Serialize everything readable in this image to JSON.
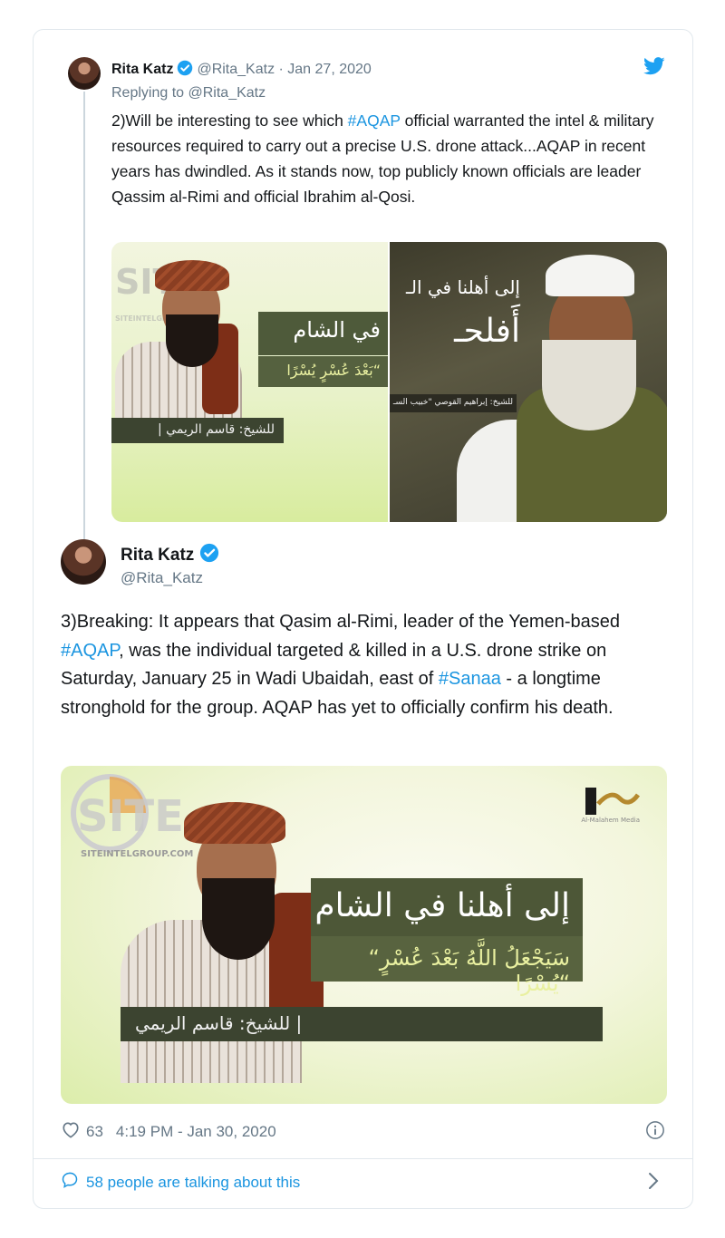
{
  "reply_tweet": {
    "author_name": "Rita Katz",
    "handle_date": "@Rita_Katz · Jan 27, 2020",
    "replying_to": "Replying to @Rita_Katz",
    "text_before_tag": "2)Will be interesting to see which ",
    "hashtag": "#AQAP",
    "text_after_tag": " official warranted the intel & military resources required to carry out a precise U.S. drone attack...AQAP in recent years has dwindled. As it stands now, top publicly known officials are leader Qassim al-Rimi and official Ibrahim al-Qosi.",
    "images": {
      "left": {
        "watermark": "SITE",
        "watermark_url": "SITEINTELGROUP.COM",
        "banner_title": "في الشام",
        "banner_quote": "بَعْدَ عُسْرٍ يُسْرًا“",
        "caption": "| للشيخ: قاسم الريمي"
      },
      "right": {
        "title_line1": "إلى أهلنا في الـ",
        "title_line2": "أَفلحـ",
        "caption": "للشيخ: إبراهيم القوصي \"خبيب السـ"
      }
    }
  },
  "main_tweet": {
    "author_name": "Rita Katz",
    "handle": "@Rita_Katz",
    "text_part1": "3)Breaking: It appears that Qasim al-Rimi, leader of the Yemen-based ",
    "hashtag1": "#AQAP",
    "text_part2": ", was the individual targeted & killed in a U.S. drone strike on Saturday, January 25 in Wadi Ubaidah, east of ",
    "hashtag2": "#Sanaa",
    "text_part3": " - a longtime stronghold for the group. AQAP has yet to officially confirm his death.",
    "image": {
      "watermark": "SITE",
      "watermark_url": "SITEINTELGROUP.COM",
      "logo_sub": "Al-Malahem Media",
      "banner_title": "إلى أهلنا في الشام",
      "banner_quote": "“سَيَجْعَلُ اللَّهُ بَعْدَ عُسْرٍ يُسْرًا“",
      "caption": "| للشيخ: قاسم الريمي"
    },
    "likes": "63",
    "timestamp": "4:19 PM - Jan 30, 2020",
    "talking": "58 people are talking about this"
  },
  "colors": {
    "link": "#1b95e0",
    "muted": "#657786",
    "border": "#e1e8ed",
    "verified": "#1da1f2"
  }
}
